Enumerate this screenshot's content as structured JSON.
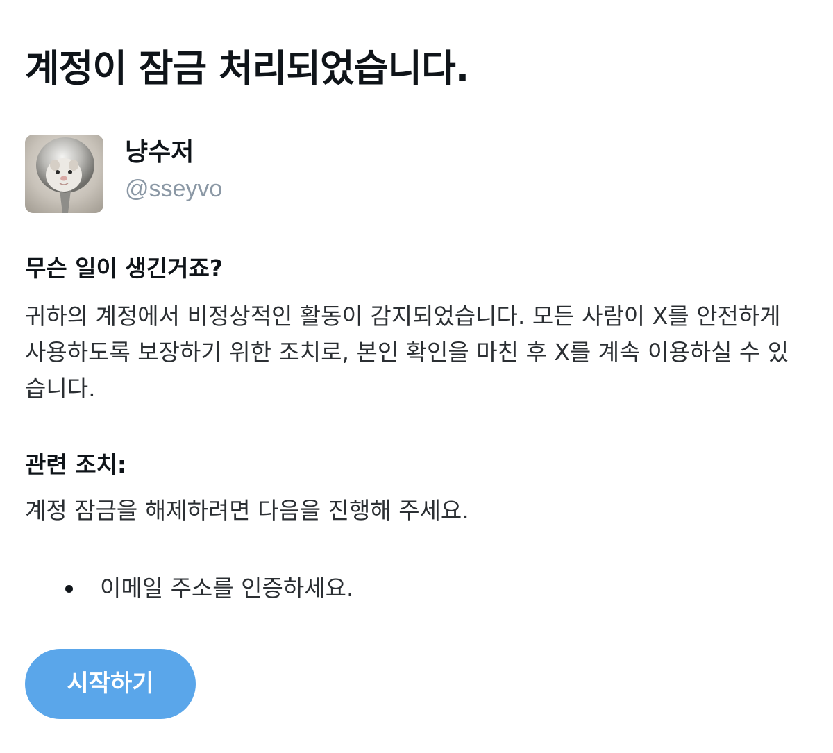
{
  "page": {
    "title": "계정이 잠금 처리되었습니다."
  },
  "profile": {
    "display_name": "냥수저",
    "handle": "@sseyvo",
    "avatar_icon": "cat-on-spoon-avatar"
  },
  "sections": {
    "what_happened": {
      "heading": "무슨 일이 생긴거죠?",
      "body": "귀하의 계정에서 비정상적인 활동이 감지되었습니다. 모든 사람이 X를 안전하게 사용하도록 보장하기 위한 조치로, 본인 확인을 마친 후 X를 계속 이용하실 수 있습니다."
    },
    "actions": {
      "heading": "관련 조치:",
      "body": "계정 잠금을 해제하려면 다음을 진행해 주세요.",
      "steps": [
        "이메일 주소를 인증하세요."
      ]
    }
  },
  "cta": {
    "start_label": "시작하기"
  },
  "colors": {
    "button_bg": "#5aa6ea",
    "handle_text": "#8b98a5",
    "title_text": "#0f1419"
  }
}
